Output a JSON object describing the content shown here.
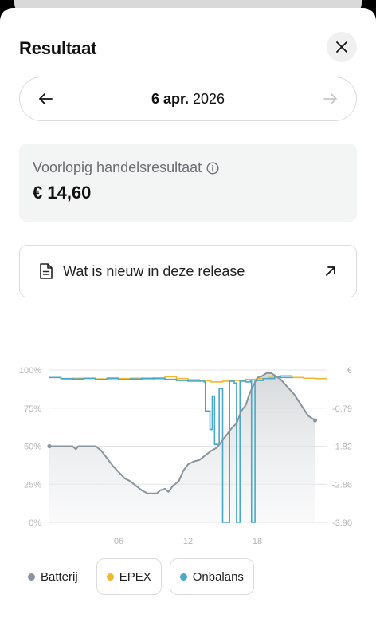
{
  "header": {
    "title": "Resultaat",
    "close_icon": "close-icon"
  },
  "date_nav": {
    "day": "6 apr.",
    "year": "2026",
    "prev_icon": "arrow-left-icon",
    "next_icon": "arrow-right-icon"
  },
  "result": {
    "label": "Voorlopig handelsresultaat",
    "value": "€ 14,60",
    "info_icon": "info-icon"
  },
  "release": {
    "label": "Wat is nieuw in deze release",
    "doc_icon": "document-icon",
    "link_icon": "arrow-up-right-icon"
  },
  "colors": {
    "battery": "#8a949c",
    "epex": "#f2b732",
    "onbalans": "#4aa8c8",
    "grid": "#e6e6e6",
    "axis_text": "#b7b7b7"
  },
  "chart_data": {
    "type": "line",
    "x_ticks": [
      "06",
      "12",
      "18"
    ],
    "x_range": [
      0,
      24
    ],
    "y_left_ticks": [
      "100%",
      "75%",
      "50%",
      "25%",
      "0%"
    ],
    "y_right_ticks": [
      "€",
      "-0.79",
      "-1.82",
      "-2.86",
      "-3.90"
    ],
    "y_left_range": [
      0,
      100
    ],
    "y_right_range": [
      -3.9,
      0.2
    ],
    "series": [
      {
        "name": "Batterij",
        "unit": "%",
        "points": [
          [
            0,
            50
          ],
          [
            2,
            50
          ],
          [
            2.3,
            48
          ],
          [
            2.5,
            50
          ],
          [
            4,
            50
          ],
          [
            4.5,
            47
          ],
          [
            5,
            42
          ],
          [
            5.5,
            37
          ],
          [
            6,
            33
          ],
          [
            6.5,
            29
          ],
          [
            7,
            27
          ],
          [
            7.5,
            24
          ],
          [
            8,
            21
          ],
          [
            8.5,
            19
          ],
          [
            9,
            19
          ],
          [
            9.3,
            19
          ],
          [
            9.6,
            21
          ],
          [
            10,
            22
          ],
          [
            10.3,
            20
          ],
          [
            10.7,
            24
          ],
          [
            11.2,
            27
          ],
          [
            11.6,
            34
          ],
          [
            12,
            38
          ],
          [
            12.5,
            40
          ],
          [
            13,
            41
          ],
          [
            13.5,
            44
          ],
          [
            14,
            47
          ],
          [
            14.5,
            49
          ],
          [
            15,
            54
          ],
          [
            15.4,
            58
          ],
          [
            15.8,
            62
          ],
          [
            16.2,
            65
          ],
          [
            16.6,
            73
          ],
          [
            17,
            77
          ],
          [
            17.3,
            84
          ],
          [
            17.6,
            89
          ],
          [
            18,
            95
          ],
          [
            18.4,
            96
          ],
          [
            18.8,
            98
          ],
          [
            19.2,
            98
          ],
          [
            19.6,
            96
          ],
          [
            20,
            94
          ],
          [
            20.6,
            89
          ],
          [
            21.2,
            84
          ],
          [
            21.8,
            77
          ],
          [
            22.4,
            70
          ],
          [
            23,
            67
          ]
        ]
      },
      {
        "name": "EPEX",
        "unit": "€",
        "points": [
          [
            0,
            0.0
          ],
          [
            1,
            -0.05
          ],
          [
            2,
            -0.02
          ],
          [
            3,
            -0.03
          ],
          [
            4,
            -0.04
          ],
          [
            5,
            -0.01
          ],
          [
            6,
            -0.03
          ],
          [
            7,
            -0.02
          ],
          [
            8,
            -0.05
          ],
          [
            9,
            -0.01
          ],
          [
            10,
            0.02
          ],
          [
            11,
            -0.03
          ],
          [
            12,
            -0.06
          ],
          [
            13,
            -0.09
          ],
          [
            14,
            -0.12
          ],
          [
            15,
            -0.1
          ],
          [
            16,
            -0.08
          ],
          [
            17,
            -0.05
          ],
          [
            18,
            -0.03
          ],
          [
            19,
            0.0
          ],
          [
            20,
            0.05
          ],
          [
            21,
            0.0
          ],
          [
            22,
            -0.02
          ],
          [
            23,
            -0.03
          ],
          [
            24,
            -0.04
          ]
        ]
      },
      {
        "name": "Onbalans",
        "unit": "€",
        "points": [
          [
            0,
            0.0
          ],
          [
            1,
            -0.03
          ],
          [
            2,
            -0.04
          ],
          [
            3,
            -0.02
          ],
          [
            4,
            -0.05
          ],
          [
            5,
            -0.03
          ],
          [
            6,
            -0.06
          ],
          [
            7,
            -0.04
          ],
          [
            8,
            -0.02
          ],
          [
            9,
            -0.03
          ],
          [
            10,
            -0.05
          ],
          [
            11,
            -0.08
          ],
          [
            12,
            -0.1
          ],
          [
            13.4,
            -0.12
          ],
          [
            13.5,
            -0.9
          ],
          [
            13.9,
            -1.4
          ],
          [
            14.1,
            -0.5
          ],
          [
            14.3,
            -1.8
          ],
          [
            14.5,
            -1.8
          ],
          [
            14.7,
            -0.3
          ],
          [
            15,
            -3.9
          ],
          [
            15.5,
            -3.9
          ],
          [
            15.6,
            -0.1
          ],
          [
            16,
            -0.15
          ],
          [
            16.2,
            -3.9
          ],
          [
            16.4,
            -3.9
          ],
          [
            16.5,
            -0.1
          ],
          [
            17,
            -0.12
          ],
          [
            17.4,
            -0.1
          ],
          [
            17.5,
            -3.9
          ],
          [
            17.7,
            -3.9
          ],
          [
            17.8,
            -0.08
          ],
          [
            18.5,
            -0.03
          ],
          [
            19.5,
            0.02
          ],
          [
            20,
            0.0
          ],
          [
            21,
            -0.02
          ]
        ]
      }
    ]
  },
  "legend": [
    {
      "label": "Batterij",
      "color": "#8a949c"
    },
    {
      "label": "EPEX",
      "color": "#f2b732"
    },
    {
      "label": "Onbalans",
      "color": "#4aa8c8"
    }
  ]
}
